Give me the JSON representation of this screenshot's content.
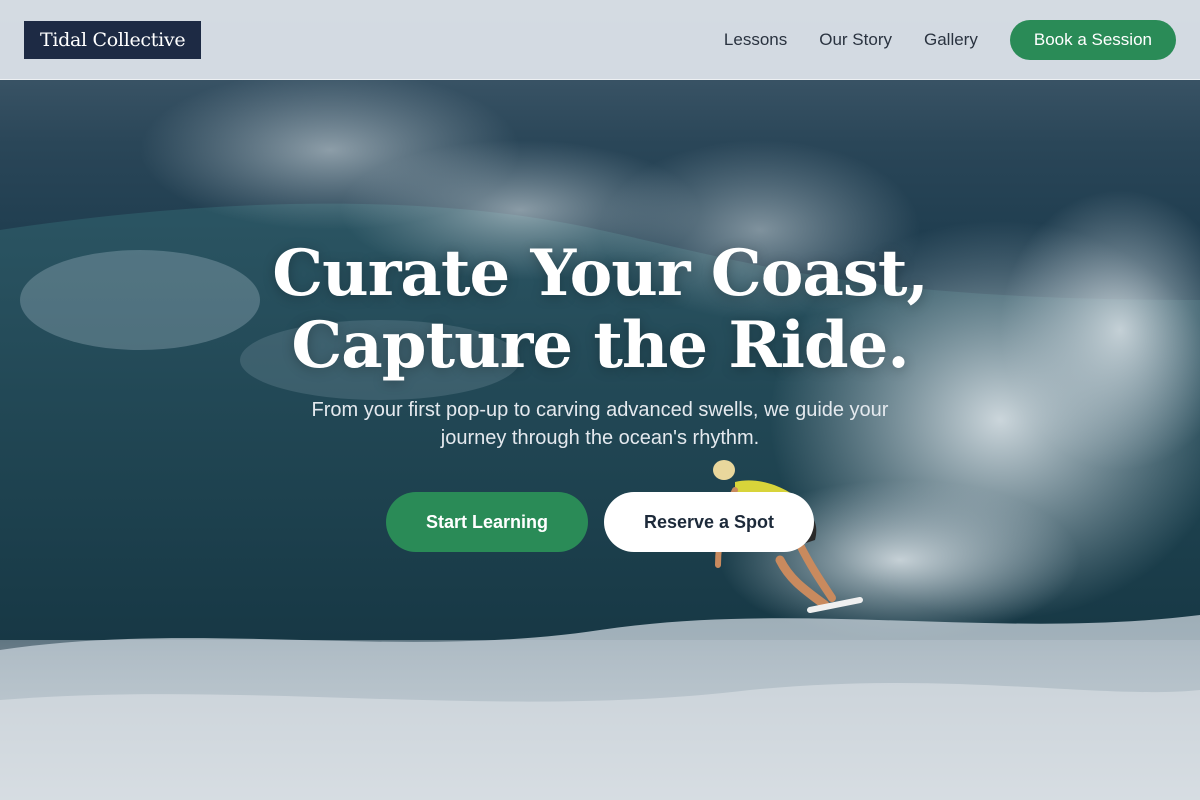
{
  "brand": {
    "name": "Tidal Collective"
  },
  "nav": {
    "links": [
      "Lessons",
      "Our Story",
      "Gallery"
    ],
    "cta_label": "Book a Session"
  },
  "hero": {
    "headline_line1": "Curate Your Coast,",
    "headline_line2": "Capture the Ride.",
    "subheadline": "From your first pop-up to carving advanced swells, we guide your journey through the ocean's rhythm.",
    "primary_cta": "Start Learning",
    "secondary_cta": "Reserve a Spot",
    "background_image": "surfer riding a large breaking wave"
  },
  "colors": {
    "accent_green": "#2a8b57",
    "logo_navy": "#1d2a44",
    "header_bg": "#dae0e7"
  }
}
